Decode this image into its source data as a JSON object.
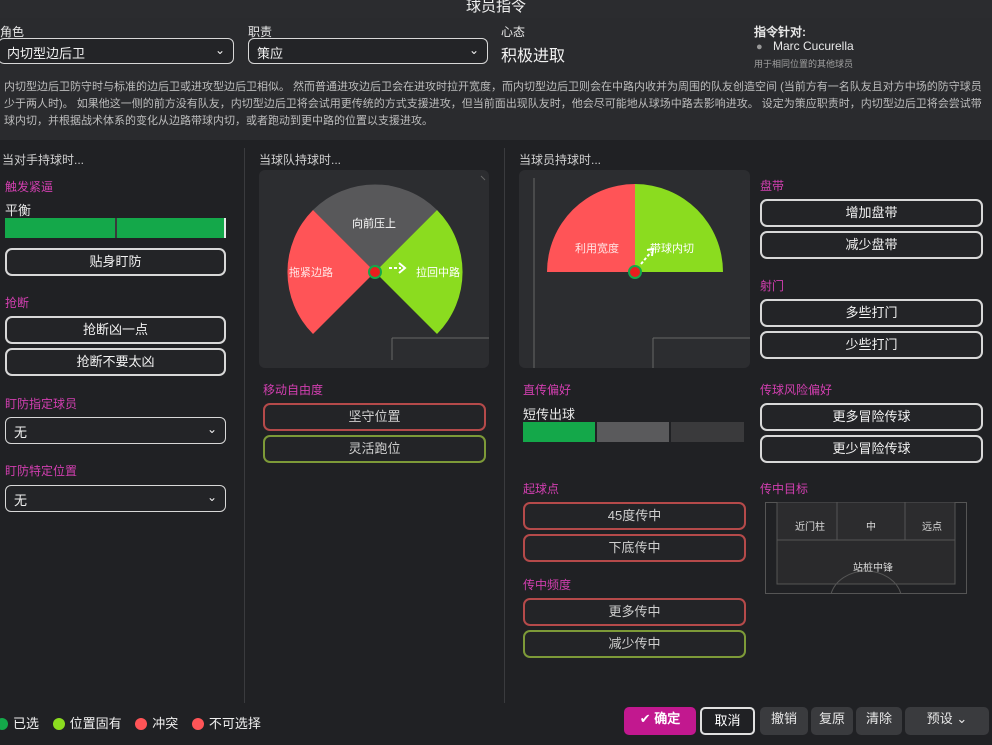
{
  "header": {
    "title": "球员指令"
  },
  "top": {
    "role_label": "角色",
    "role_value": "内切型边后卫",
    "duty_label": "职责",
    "duty_value": "策应",
    "mentality_label": "心态",
    "mentality_value": "积极进取",
    "target_label": "指令针对:",
    "target_player": "Marc Cucurella",
    "target_note": "用于相同位置的其他球员",
    "description": "内切型边后卫防守时与标准的边后卫或进攻型边后卫相似。 然而普通进攻边后卫会在进攻时拉开宽度，而内切型边后卫则会在中路内收并为周围的队友创造空间 (当前方有一名队友且对方中场的防守球员少于两人时)。 如果他这一侧的前方没有队友，内切型边后卫将会试用更传统的方式支援进攻，但当前面出现队友时，他会尽可能地从球场中路去影响进攻。 设定为策应职责时，内切型边后卫将会尝试带球内切，并根据战术体系的变化从边路带球内切，或者跑动到更中路的位置以支援进攻。"
  },
  "col1": {
    "heading": "当对手持球时...",
    "press_title": "触发紧逼",
    "press_value": "平衡",
    "press_level": 0.97,
    "tight_marking": "贴身盯防",
    "tackle_title": "抢断",
    "tackle_harder": "抢断凶一点",
    "tackle_softer": "抢断不要太凶",
    "mark_player_title": "盯防指定球员",
    "mark_player_value": "无",
    "mark_position_title": "盯防特定位置",
    "mark_position_value": "无"
  },
  "col2": {
    "heading": "当球队持球时...",
    "wheel_top": "向前压上",
    "wheel_left": "拖紧边路",
    "wheel_right": "拉回中路",
    "movement_title": "移动自由度",
    "hold_position": "坚守位置",
    "roam": "灵活跑位"
  },
  "col3": {
    "heading": "当球员持球时...",
    "wheel_left": "利用宽度",
    "wheel_right": "带球内切",
    "pass_pref_title": "直传偏好",
    "pass_pref_value": "短传出球",
    "pass_pref_level": 1,
    "cross_from_title": "起球点",
    "cross_45": "45度传中",
    "cross_byline": "下底传中",
    "cross_freq_title": "传中频度",
    "cross_more": "更多传中",
    "cross_less": "减少传中"
  },
  "col4": {
    "dribble_title": "盘带",
    "dribble_more": "增加盘带",
    "dribble_less": "减少盘带",
    "shoot_title": "射门",
    "shoot_more": "多些打门",
    "shoot_less": "少些打门",
    "risk_title": "传球风险偏好",
    "risk_more": "更多冒险传球",
    "risk_less": "更少冒险传球",
    "cross_target_title": "传中目标",
    "near_post": "近门柱",
    "centre": "中",
    "far_post": "远点",
    "target_man": "站桩中锋"
  },
  "legend": {
    "selected": "已选",
    "inherent": "位置固有",
    "conflict": "冲突",
    "unavailable": "不可选择"
  },
  "footer": {
    "confirm": "确定",
    "cancel": "取消",
    "undo": "撤销",
    "reset": "复原",
    "clear": "清除",
    "presets": "预设"
  },
  "colors": {
    "green": "#14a84a",
    "lime": "#8bdc1f",
    "red": "#ff5457",
    "gray": "#5a5a5c",
    "magenta": "#c2188f",
    "accent": "#d23fb0"
  }
}
